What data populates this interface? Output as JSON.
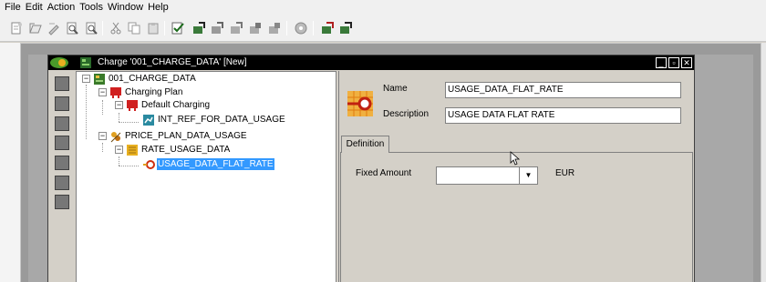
{
  "menu": [
    "File",
    "Edit",
    "Action",
    "Tools",
    "Window",
    "Help"
  ],
  "toolbar_icons": [
    "new-icon",
    "open-icon",
    "edit-icon",
    "find-icon",
    "find-next-icon",
    "cut-icon",
    "copy-icon",
    "paste-icon",
    "validate-icon",
    "export-icon",
    "import-icon",
    "import-all-icon",
    "compare-icon",
    "merge-icon",
    "deploy-icon",
    "report-icon",
    "report-all-icon"
  ],
  "child_window": {
    "title": "Charge '001_CHARGE_DATA' [New]"
  },
  "tree": {
    "nodes": [
      {
        "label": "001_CHARGE_DATA",
        "icon": "charge-icon",
        "expander": "−"
      },
      {
        "label": "Charging Plan",
        "icon": "charging-plan-icon",
        "expander": "−"
      },
      {
        "label": "Default Charging",
        "icon": "default-charging-icon",
        "expander": "−"
      },
      {
        "label": "INT_REF_FOR_DATA_USAGE",
        "icon": "interface-reference-icon",
        "expander": ""
      },
      {
        "label": "PRICE_PLAN_DATA_USAGE",
        "icon": "price-plan-icon",
        "expander": "−"
      },
      {
        "label": "RATE_USAGE_DATA",
        "icon": "rate-icon",
        "expander": "−"
      },
      {
        "label": "USAGE_DATA_FLAT_RATE",
        "icon": "flat-rate-icon",
        "expander": "",
        "selected": true
      }
    ]
  },
  "form": {
    "name_label": "Name",
    "name_value": "USAGE_DATA_FLAT_RATE",
    "description_label": "Description",
    "description_value": "USAGE DATA FLAT RATE",
    "tab_label": "Definition",
    "fixed_amount_label": "Fixed Amount",
    "fixed_amount_value": "",
    "currency": "EUR"
  },
  "colors": {
    "selection": "#3399ff",
    "titlebar": "#000000",
    "window_bg": "#d4d0c8"
  }
}
